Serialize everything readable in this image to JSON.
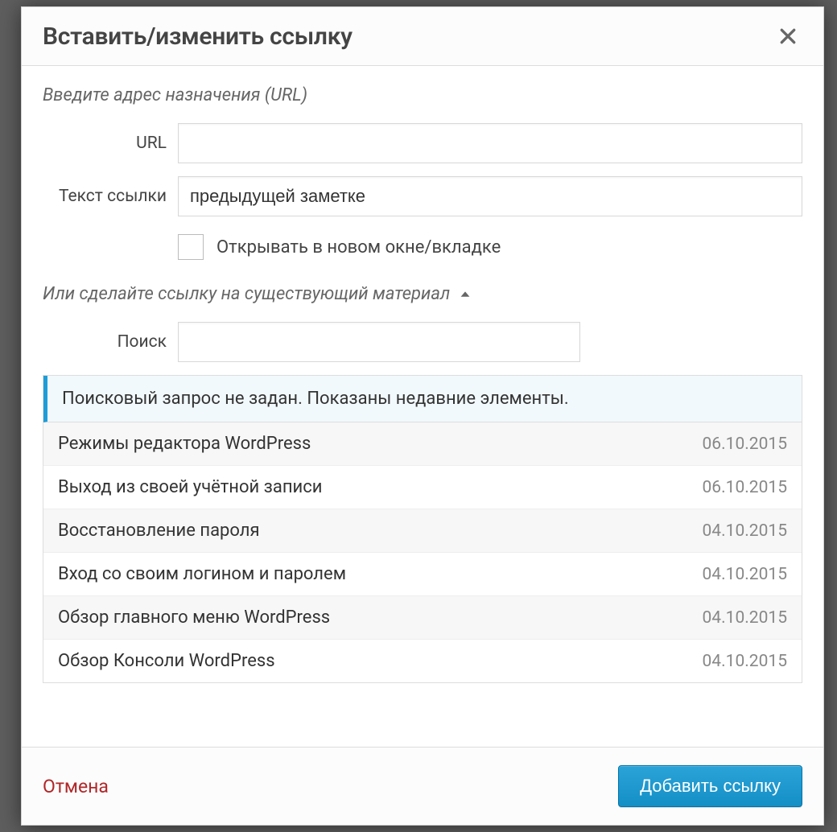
{
  "dialog": {
    "title": "Вставить/изменить ссылку",
    "section1_label": "Введите адрес назначения (URL)",
    "url_label": "URL",
    "url_value": "",
    "linktext_label": "Текст ссылки",
    "linktext_value": "предыдущей заметке",
    "newtab_label": "Открывать в новом окне/вкладке",
    "newtab_checked": false,
    "section2_label": "Или сделайте ссылку на существующий материал",
    "search_label": "Поиск",
    "search_value": "",
    "results_header": "Поисковый запрос не задан. Показаны недавние элементы.",
    "results": [
      {
        "title": "Режимы редактора WordPress",
        "date": "06.10.2015"
      },
      {
        "title": "Выход из своей учётной записи",
        "date": "06.10.2015"
      },
      {
        "title": "Восстановление пароля",
        "date": "04.10.2015"
      },
      {
        "title": "Вход со своим логином и паролем",
        "date": "04.10.2015"
      },
      {
        "title": "Обзор главного меню WordPress",
        "date": "04.10.2015"
      },
      {
        "title": "Обзор Консоли WordPress",
        "date": "04.10.2015"
      }
    ],
    "cancel_label": "Отмена",
    "submit_label": "Добавить ссылку"
  }
}
